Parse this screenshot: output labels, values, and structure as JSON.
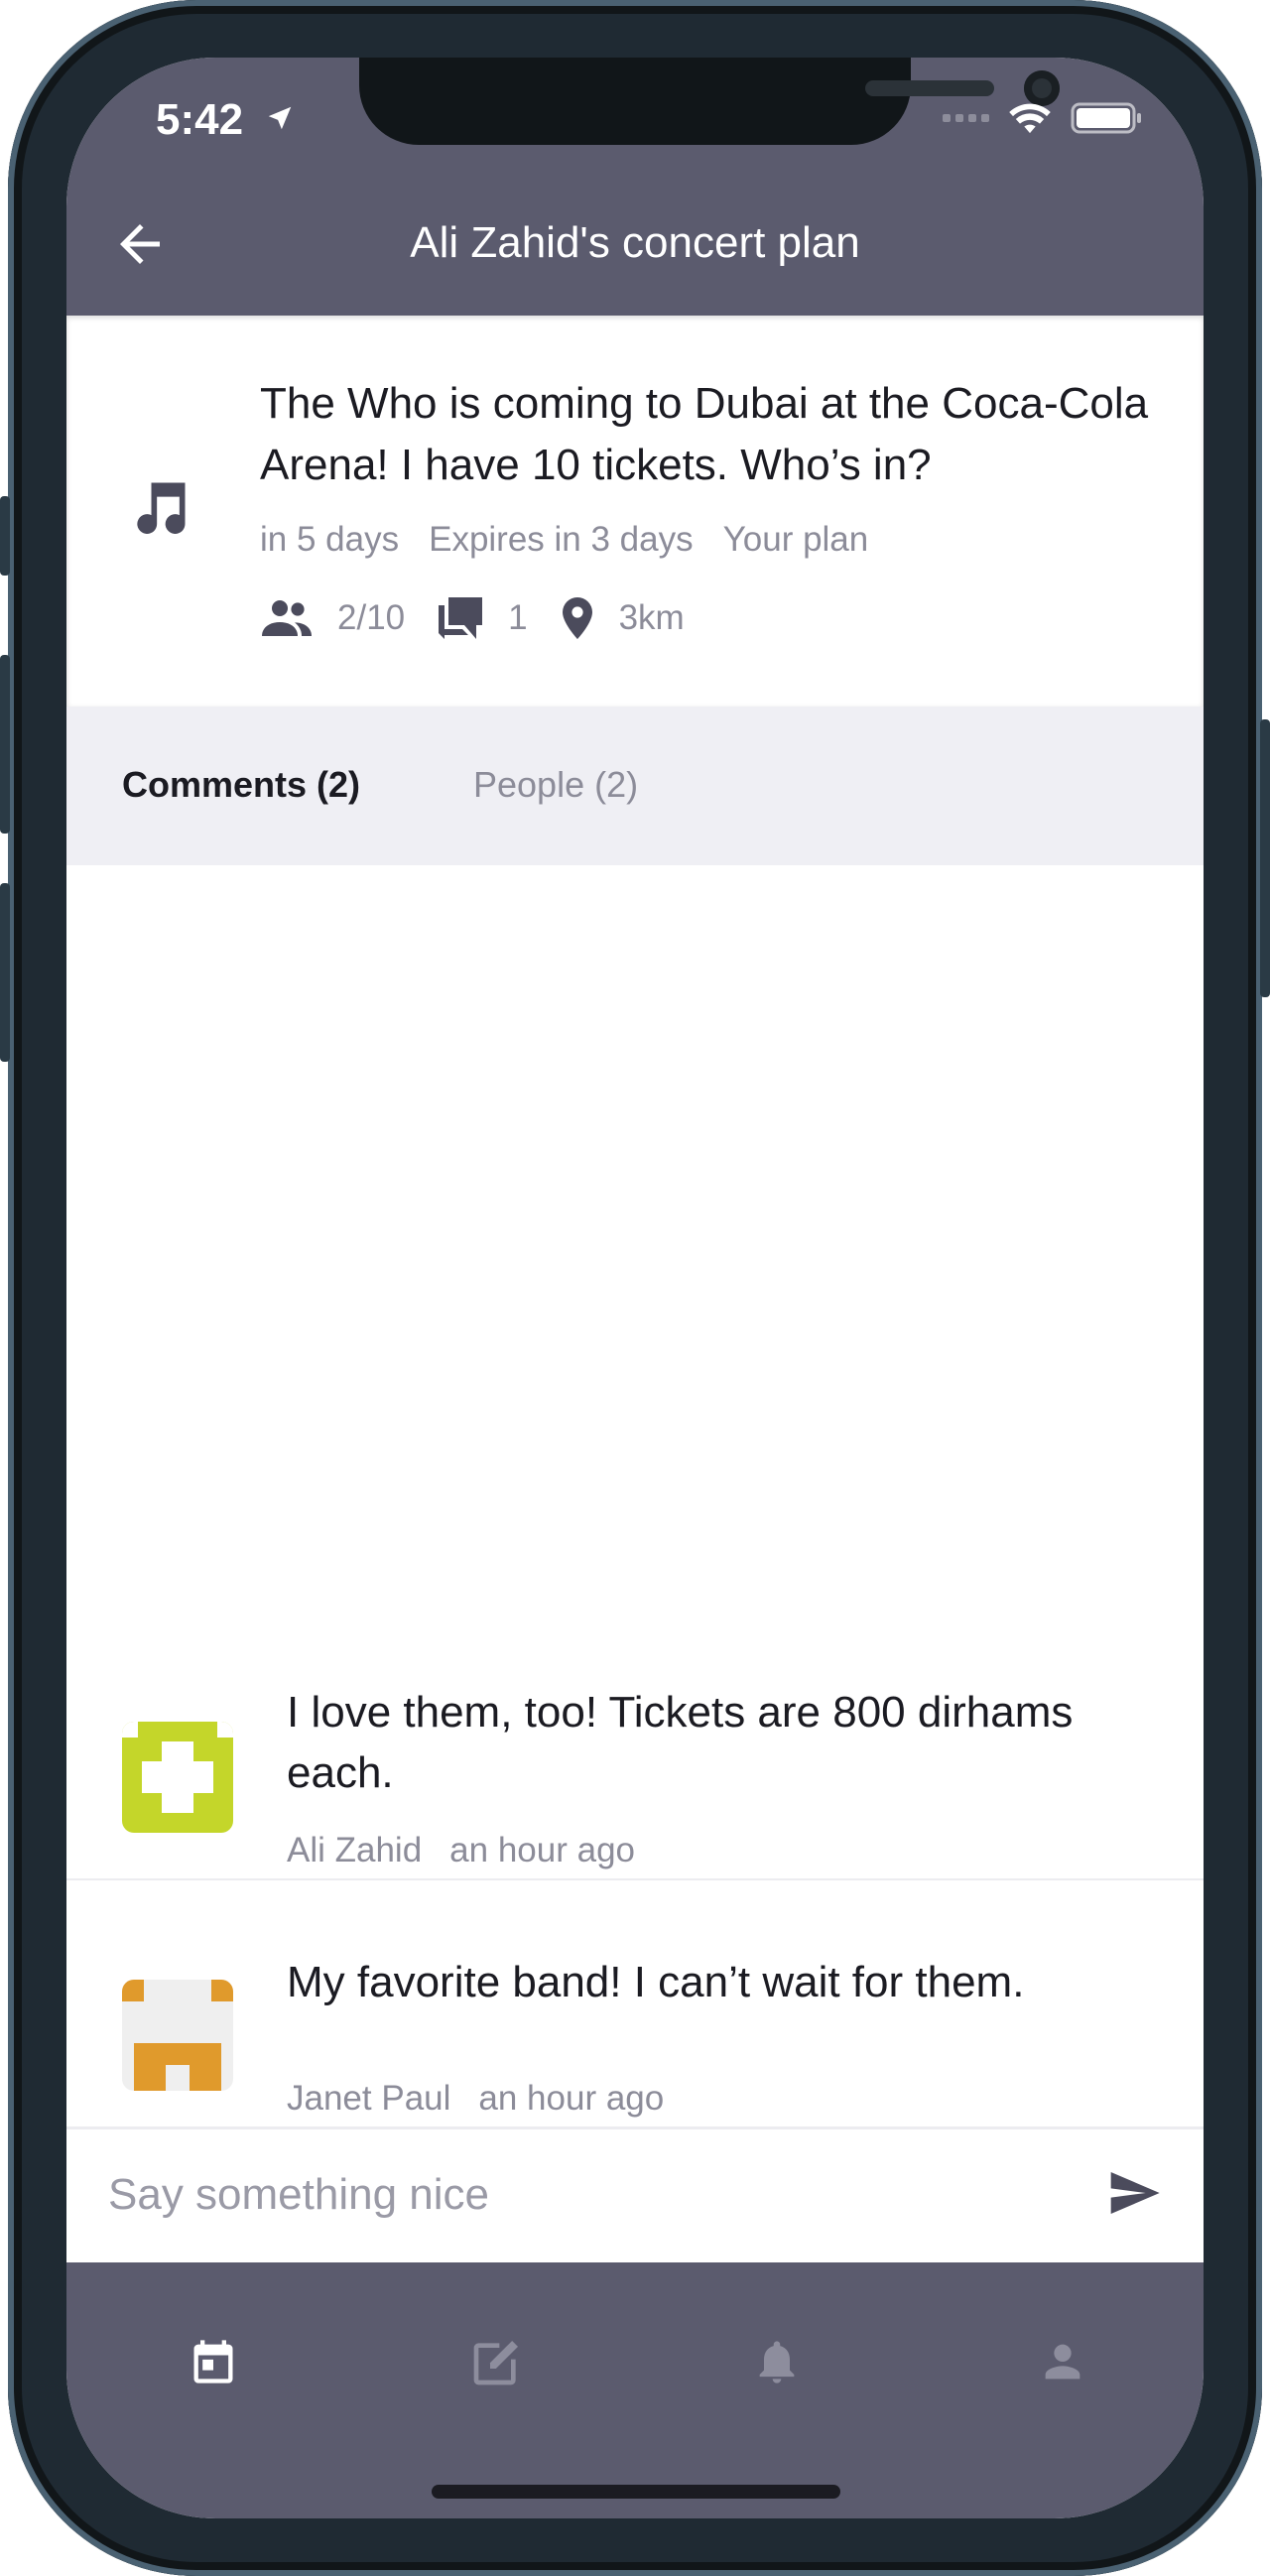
{
  "status_bar": {
    "time": "5:42"
  },
  "header": {
    "title": "Ali Zahid's concert plan"
  },
  "plan": {
    "text": "The Who is coming to Dubai at the Coca-Cola Arena! I have 10 tickets. Who’s in?",
    "meta": [
      "in 5 days",
      "Expires in 3 days",
      "Your plan"
    ],
    "attendees": "2/10",
    "comments_count": "1",
    "distance": "3km",
    "icon": "music-note-icon"
  },
  "tabs": [
    {
      "label": "Comments (2)",
      "active": true
    },
    {
      "label": "People (2)",
      "active": false
    }
  ],
  "comments": [
    {
      "text": "I love them, too! Tickets are 800 dirhams each.",
      "author": "Ali Zahid",
      "time": "an hour ago",
      "avatar_color": "#c4d62a"
    },
    {
      "text": "My favorite band! I can’t wait for them.",
      "author": "Janet Paul",
      "time": "an hour ago",
      "avatar_color": "#e09a2c"
    }
  ],
  "composer": {
    "placeholder": "Say something nice"
  },
  "bottom_nav": [
    "calendar-icon",
    "edit-icon",
    "bell-icon",
    "person-icon"
  ],
  "colors": {
    "bar": "#5b5b6e",
    "tabs_bg": "#efeff4",
    "muted": "#8c8c99",
    "text": "#1b1b22"
  }
}
